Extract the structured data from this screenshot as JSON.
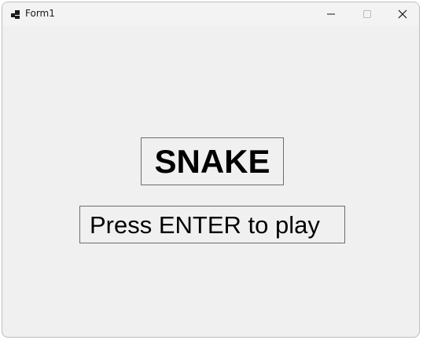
{
  "window": {
    "title": "Form1",
    "app_icon": "winforms-app-icon",
    "minimize_icon": "minimize-icon",
    "maximize_icon": "maximize-icon",
    "close_icon": "close-icon"
  },
  "game": {
    "title_label": "SNAKE",
    "prompt_label": "Press ENTER to play"
  },
  "colors": {
    "background": "#f0f0f0",
    "titlebar": "#f3f3f3",
    "text": "#000000",
    "border": "#6e6e6e"
  }
}
